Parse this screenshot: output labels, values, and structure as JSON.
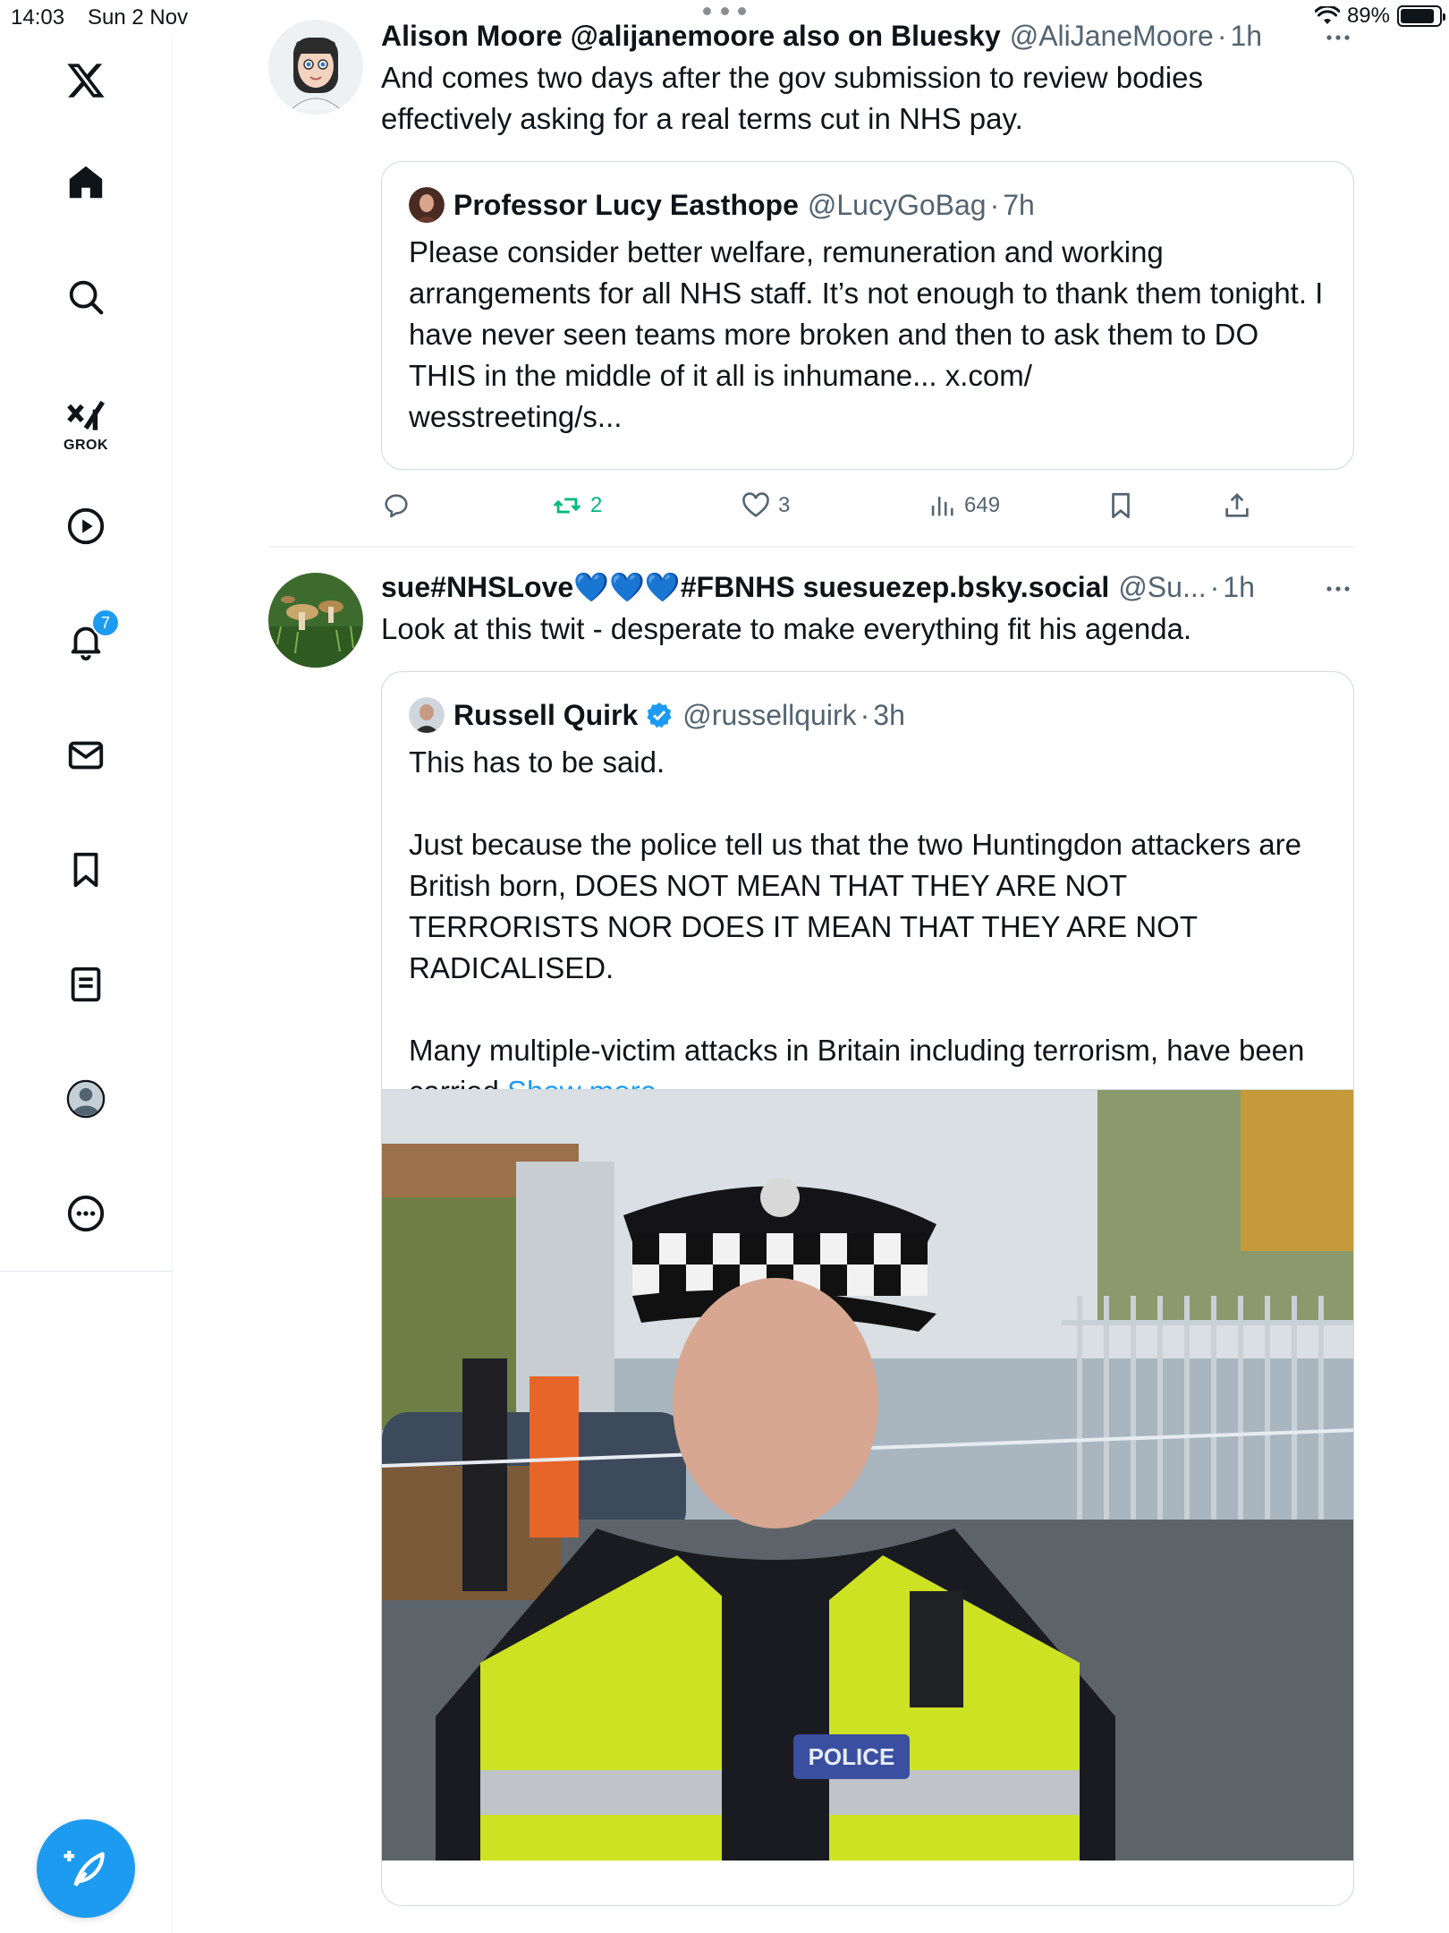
{
  "status_bar": {
    "time": "14:03",
    "date": "Sun 2 Nov",
    "battery_text": "89%",
    "battery_level": 0.89
  },
  "sidebar": {
    "items": [
      {
        "name": "x-logo",
        "label": ""
      },
      {
        "name": "home",
        "label": ""
      },
      {
        "name": "search",
        "label": ""
      },
      {
        "name": "grok",
        "label": "GROK"
      },
      {
        "name": "videos",
        "label": ""
      },
      {
        "name": "notifications",
        "label": "",
        "badge": "7"
      },
      {
        "name": "messages",
        "label": ""
      },
      {
        "name": "bookmarks",
        "label": ""
      },
      {
        "name": "lists",
        "label": ""
      },
      {
        "name": "profile",
        "label": ""
      },
      {
        "name": "more",
        "label": ""
      }
    ]
  },
  "tweets": [
    {
      "author_name": "Alison Moore @alijanemoore also on Bluesky",
      "author_handle": "@AliJaneMoore",
      "time": "1h",
      "text": "And comes two days after the gov submission to review bodies effectively asking for a real terms cut in NHS pay.",
      "quote": {
        "author_name": "Professor Lucy Easthope",
        "author_handle": "@LucyGoBag",
        "time": "7h",
        "text": "Please consider better welfare, remuneration and working arrangements for all NHS staff. It’s not enough to thank them tonight. I have never seen teams more broken and then to ask them to DO THIS in the middle of it all is inhumane... x.com/\nwesstreeting/s..."
      },
      "actions": {
        "replies": "",
        "reposts": "2",
        "likes": "3",
        "views": "649"
      }
    },
    {
      "author_name": "sue#NHSLove💙💙💙#FBNHS suesuezep.bsky.social",
      "author_handle": "@Su...",
      "time": "1h",
      "text": "Look at this twit - desperate to make everything fit his agenda.",
      "quote": {
        "author_name": "Russell Quirk",
        "author_handle": "@russellquirk",
        "time": "3h",
        "text": "This has to be said.\n\nJust because the police tell us that the two Huntingdon attackers are British born, DOES NOT MEAN THAT THEY ARE NOT TERRORISTS NOR DOES IT MEAN THAT THEY ARE NOT RADICALISED.\n\nMany multiple-victim attacks in Britain including terrorism, have been carried",
        "show_more": "Show more",
        "image_text": "POLICE"
      }
    }
  ],
  "colors": {
    "accent": "#1d9bf0",
    "repost": "#00ba7c",
    "muted": "#536471",
    "text": "#0f1419"
  }
}
